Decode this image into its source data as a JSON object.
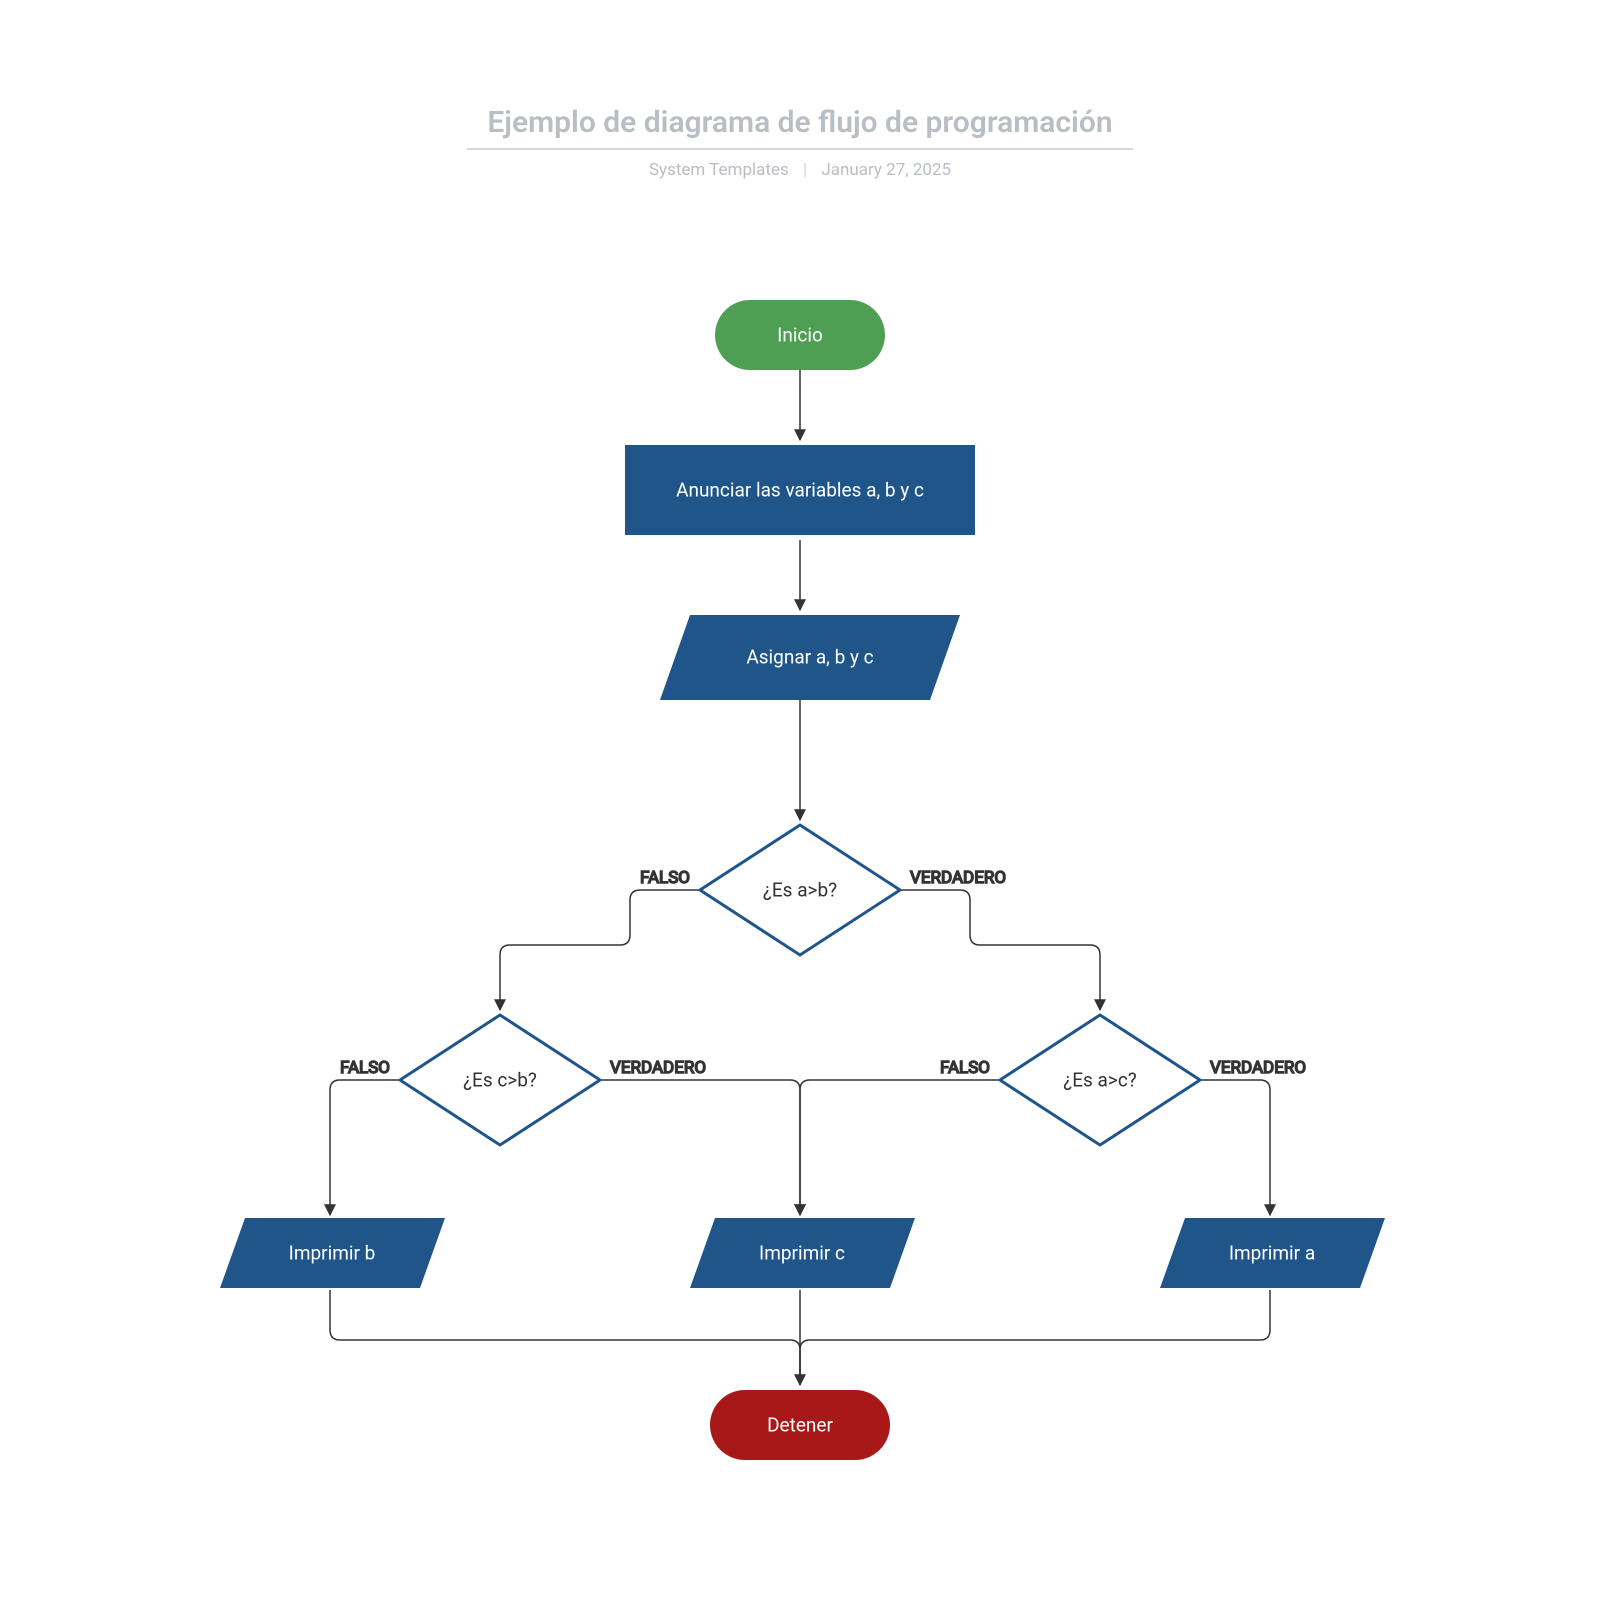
{
  "header": {
    "title": "Ejemplo de diagrama de flujo de programación",
    "author": "System Templates",
    "date": "January 27, 2025"
  },
  "nodes": {
    "start": {
      "label": "Inicio"
    },
    "declare": {
      "label": "Anunciar las variables a, b y c"
    },
    "assign": {
      "label": "Asignar a, b y c"
    },
    "d_ab": {
      "label": "¿Es a>b?"
    },
    "d_cb": {
      "label": "¿Es c>b?"
    },
    "d_ac": {
      "label": "¿Es a>c?"
    },
    "print_b": {
      "label": "Imprimir b"
    },
    "print_c": {
      "label": "Imprimir c"
    },
    "print_a": {
      "label": "Imprimir a"
    },
    "stop": {
      "label": "Detener"
    }
  },
  "labels": {
    "true": "VERDADERO",
    "false": "FALSO"
  },
  "colors": {
    "start": "#4e9f53",
    "process": "#20558a",
    "decisionStroke": "#20558a",
    "stop": "#a81818",
    "line": "#333333"
  }
}
